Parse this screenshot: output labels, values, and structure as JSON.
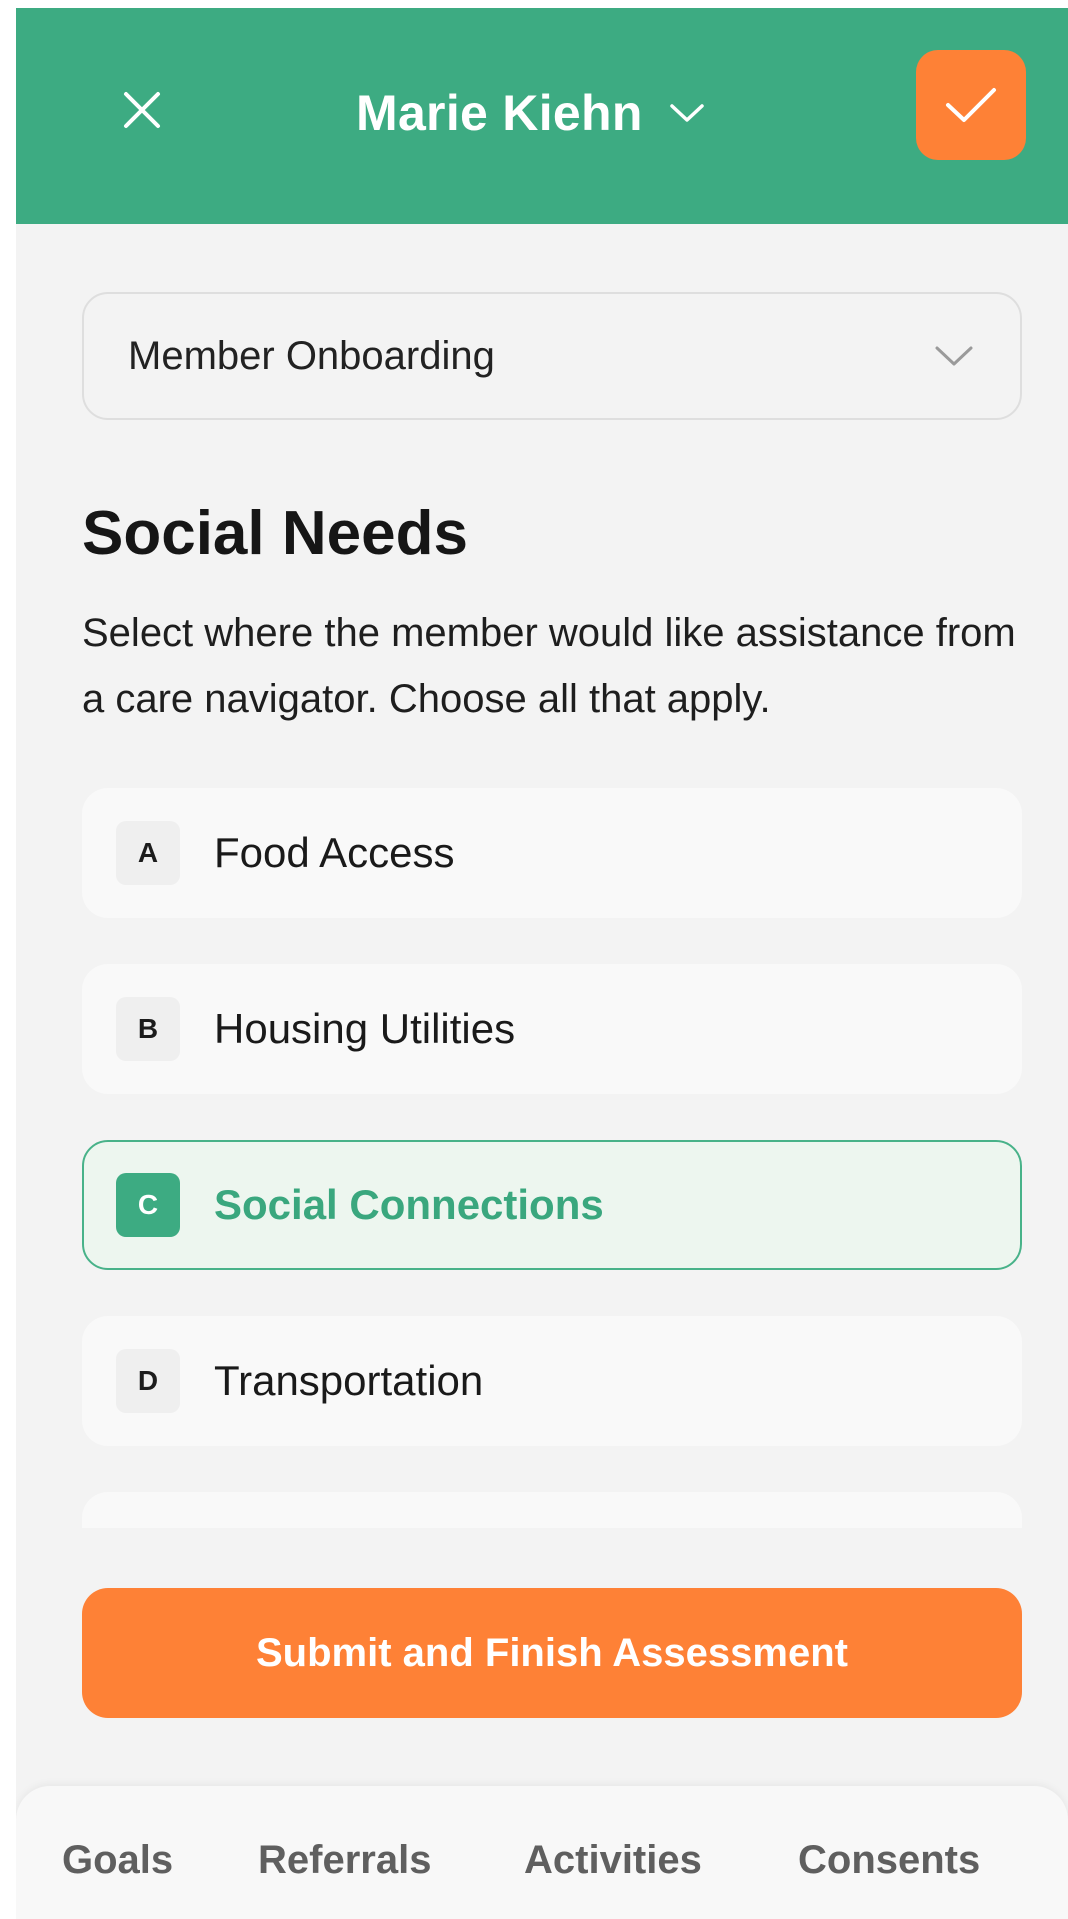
{
  "header": {
    "member_name": "Marie Kiehn",
    "close_icon": "close-icon",
    "dropdown_icon": "chevron-down-icon",
    "confirm_icon": "check-icon",
    "background_color": "#3dab82",
    "confirm_color": "#fe8136"
  },
  "assessment_select": {
    "value": "Member Onboarding",
    "icon": "chevron-down-icon"
  },
  "section": {
    "title": "Social Needs",
    "description": "Select where the member would like assistance from a care navigator. Choose all that apply."
  },
  "options": [
    {
      "key": "A",
      "label": "Food Access",
      "selected": false
    },
    {
      "key": "B",
      "label": "Housing Utilities",
      "selected": false
    },
    {
      "key": "C",
      "label": "Social Connections",
      "selected": true
    },
    {
      "key": "D",
      "label": "Transportation",
      "selected": false
    }
  ],
  "submit": {
    "label": "Submit and Finish Assessment",
    "color": "#fe8136"
  },
  "tabs": [
    "Goals",
    "Referrals",
    "Activities",
    "Consents"
  ],
  "colors": {
    "accent_green": "#3dab82",
    "accent_orange": "#fe8136",
    "selected_background": "#edf6ef"
  }
}
